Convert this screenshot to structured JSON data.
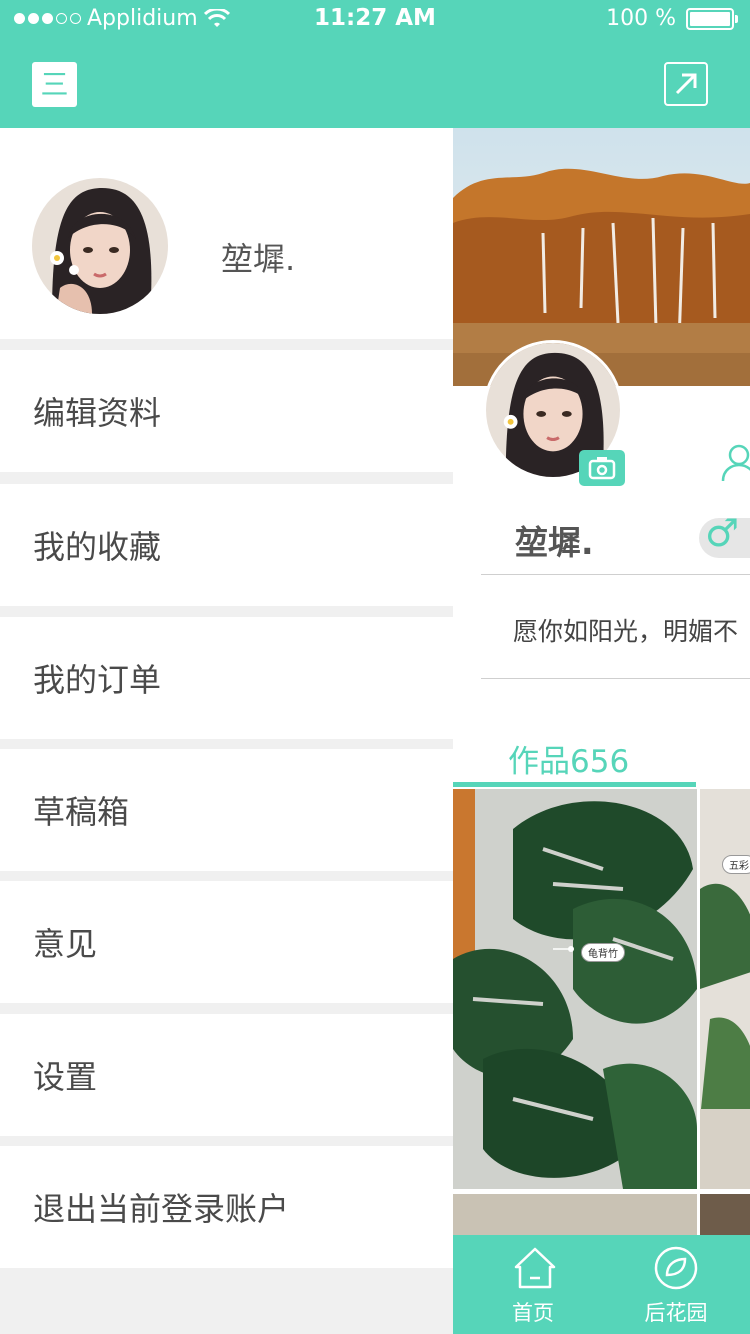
{
  "status_bar": {
    "carrier": "Applidium",
    "time": "11:27 AM",
    "battery": "100 %"
  },
  "nav": {
    "menu_glyph": "三",
    "menu_icon": "menu-icon",
    "share_icon": "share-arrow-icon"
  },
  "drawer": {
    "username": "堃墀.",
    "items": [
      {
        "label": "编辑资料"
      },
      {
        "label": "我的收藏"
      },
      {
        "label": "我的订单"
      },
      {
        "label": "草稿箱"
      },
      {
        "label": "意见"
      },
      {
        "label": "设置"
      },
      {
        "label": "退出当前登录账户"
      }
    ]
  },
  "profile": {
    "name": "堃墀.",
    "gender_symbol": "♂",
    "bio": "愿你如阳光，明媚不",
    "works_label": "作品656",
    "plant_tags": [
      "龟背竹",
      "五彩"
    ]
  },
  "tabbar": {
    "tabs": [
      {
        "label": "首页",
        "icon": "home-icon"
      },
      {
        "label": "后花园",
        "icon": "leaf-icon"
      }
    ]
  },
  "colors": {
    "accent": "#56d5b9",
    "background": "#f0f0f0"
  }
}
